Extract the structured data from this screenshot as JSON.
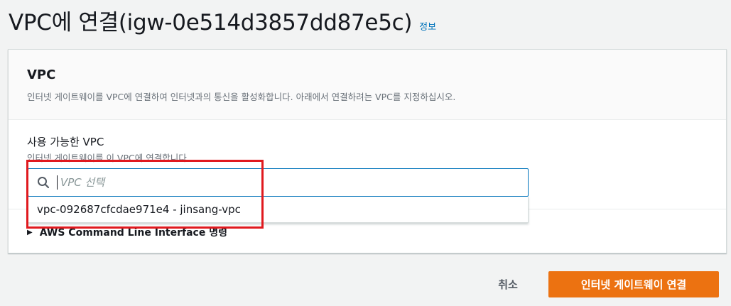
{
  "header": {
    "title": "VPC에 연결(igw-0e514d3857dd87e5c)",
    "info_link": "정보"
  },
  "card": {
    "title": "VPC",
    "description": "인터넷 게이트웨이를 VPC에 연결하여 인터넷과의 통신을 활성화합니다. 아래에서 연결하려는 VPC를 지정하십시오."
  },
  "field": {
    "label": "사용 가능한 VPC",
    "description": "인터넷 게이트웨이를 이 VPC에 연결합니다.",
    "placeholder": "VPC 선택"
  },
  "dropdown": {
    "options": [
      "vpc-092687cfcdae971e4 - jinsang-vpc"
    ]
  },
  "cli": {
    "label": "AWS Command Line Interface 명령"
  },
  "footer": {
    "cancel_label": "취소",
    "submit_label": "인터넷 게이트웨이 연결"
  },
  "colors": {
    "primary": "#ec7211",
    "link": "#0073bb",
    "highlight": "#e0191e"
  }
}
